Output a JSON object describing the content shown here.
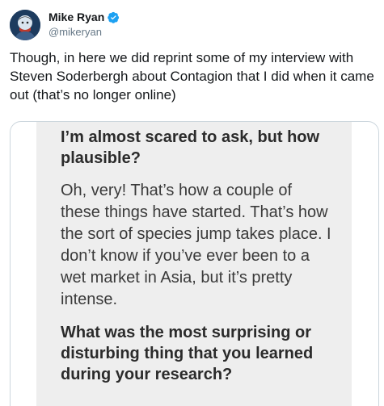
{
  "tweet": {
    "author": {
      "display_name": "Mike Ryan",
      "handle": "@mikeryan",
      "verified": true
    },
    "text": "Though, in here we did reprint some of my interview with Steven Soderbergh about Contagion that I did when it came out (that’s no longer online)",
    "media": {
      "question_1": "I’m almost scared to ask, but how plausible?",
      "answer_1": "Oh, very! That’s how a couple of these things have started. That’s how the sort of species jump takes place. I don’t know if you’ve ever been to a wet market in Asia, but it’s pretty intense.",
      "question_2": "What was the most surprising or disturbing thing that you learned during your research?"
    }
  },
  "colors": {
    "verified_badge": "#1da1f2",
    "text_primary": "#14171a",
    "text_secondary": "#657786",
    "card_border": "#ccd6dd",
    "article_background": "#eeeeee"
  }
}
